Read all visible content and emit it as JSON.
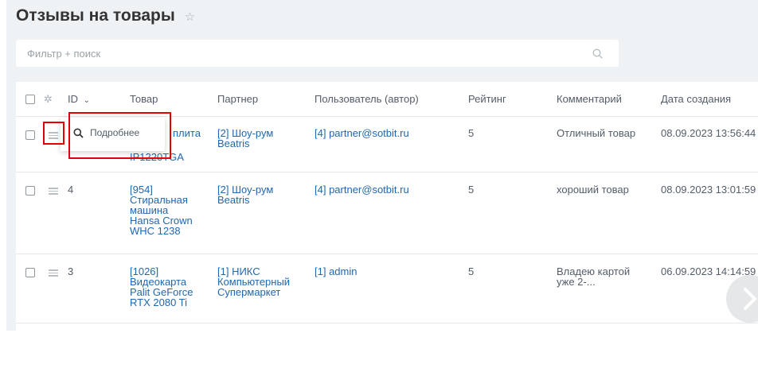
{
  "page": {
    "title": "Отзывы на товары",
    "favorite_icon": "star-icon"
  },
  "search": {
    "placeholder": "Фильтр + поиск",
    "icon": "search-icon"
  },
  "table": {
    "columns": {
      "id": "ID",
      "product": "Товар",
      "partner": "Партнер",
      "user": "Пользователь (автор)",
      "rating": "Рейтинг",
      "comment": "Комментарий",
      "created": "Дата создания"
    },
    "rows": [
      {
        "id": "",
        "product": [
          "плита",
          "IP1220TGA"
        ],
        "partner": [
          "[2] Шоу-рум",
          "Beatris"
        ],
        "user": "[4] partner@sotbit.ru",
        "rating": "5",
        "comment": [
          "Отличный товар"
        ],
        "created": "08.09.2023 13:56:44"
      },
      {
        "id": "4",
        "product": [
          "[954]",
          "Стиральная",
          "машина",
          "Hansa Crown",
          "WHC 1238"
        ],
        "partner": [
          "[2] Шоу-рум",
          "Beatris"
        ],
        "user": "[4] partner@sotbit.ru",
        "rating": "5",
        "comment": [
          "хороший товар"
        ],
        "created": "08.09.2023 13:01:59"
      },
      {
        "id": "3",
        "product": [
          "[1026]",
          "Видеокарта",
          "Palit GeForce",
          "RTX 2080 Ti"
        ],
        "partner": [
          "[1] НИКС",
          "Компьютерный",
          "Супермаркет"
        ],
        "user": "[1] admin",
        "rating": "5",
        "comment": [
          "Владею картой",
          "уже 2-..."
        ],
        "created": "06.09.2023 14:14:59"
      }
    ]
  },
  "context_menu": {
    "details_label": "Подробнее"
  },
  "colors": {
    "background": "#eef2f4",
    "link": "#2067b0",
    "highlight": "#e40000"
  }
}
